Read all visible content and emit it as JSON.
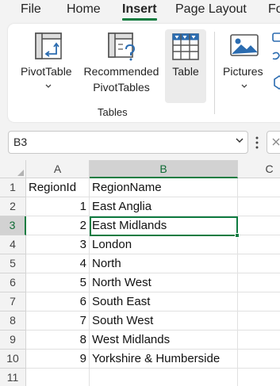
{
  "menu": {
    "tabs": [
      {
        "label": "File",
        "active": false
      },
      {
        "label": "Home",
        "active": false
      },
      {
        "label": "Insert",
        "active": true
      },
      {
        "label": "Page Layout",
        "active": false
      },
      {
        "label": "Fo",
        "active": false
      }
    ]
  },
  "ribbon": {
    "pivottable": {
      "label": "PivotTable",
      "icon": "pivottable-icon"
    },
    "recommended": {
      "label_line1": "Recommended",
      "label_line2": "PivotTables",
      "icon": "recommended-pivottables-icon"
    },
    "table": {
      "label": "Table",
      "icon": "table-icon"
    },
    "pictures": {
      "label": "Pictures",
      "icon": "pictures-icon"
    },
    "group_label": "Tables",
    "colors": {
      "accent_green": "#107c41",
      "icon_blue": "#2b6cb0"
    }
  },
  "namebox": {
    "value": "B3"
  },
  "sheet": {
    "columns": [
      {
        "label": "A",
        "selected": false
      },
      {
        "label": "B",
        "selected": true
      },
      {
        "label": "C",
        "selected": false
      }
    ],
    "rows": [
      {
        "num": "1",
        "a": "RegionId",
        "b": "RegionName"
      },
      {
        "num": "2",
        "a": "1",
        "b": "East Anglia"
      },
      {
        "num": "3",
        "a": "2",
        "b": "East Midlands"
      },
      {
        "num": "4",
        "a": "3",
        "b": "London"
      },
      {
        "num": "5",
        "a": "4",
        "b": "North"
      },
      {
        "num": "6",
        "a": "5",
        "b": "North West"
      },
      {
        "num": "7",
        "a": "6",
        "b": "South East"
      },
      {
        "num": "8",
        "a": "7",
        "b": "South West"
      },
      {
        "num": "9",
        "a": "8",
        "b": "West Midlands"
      },
      {
        "num": "10",
        "a": "9",
        "b": "Yorkshire & Humberside"
      },
      {
        "num": "11",
        "a": "",
        "b": ""
      }
    ],
    "active_cell": "B3"
  }
}
